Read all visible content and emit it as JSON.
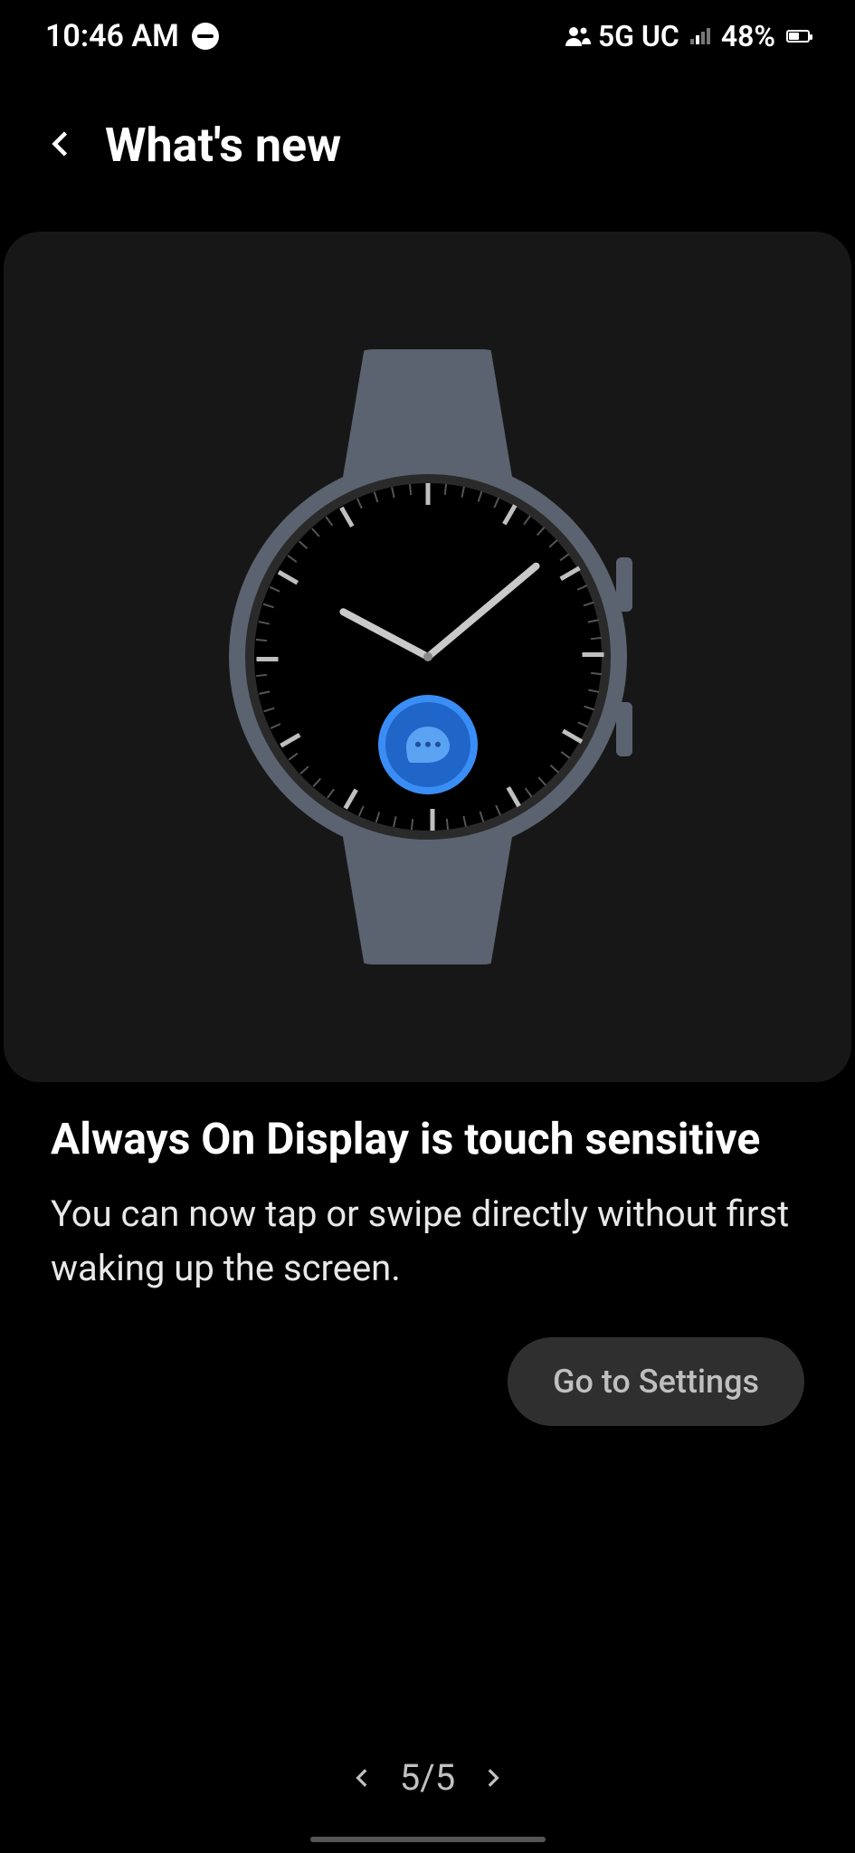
{
  "status": {
    "time": "10:46 AM",
    "network_label": "5G UC",
    "battery_pct": "48%",
    "battery_fill_css_width": "48%"
  },
  "header": {
    "title": "What's new"
  },
  "feature": {
    "heading": "Always On Display is touch sensitive",
    "body": "You can now tap or swipe directly without first waking up the screen.",
    "cta": "Go to Settings"
  },
  "pager": {
    "label": "5/5"
  },
  "watch": {
    "complication_icon": "messages"
  }
}
